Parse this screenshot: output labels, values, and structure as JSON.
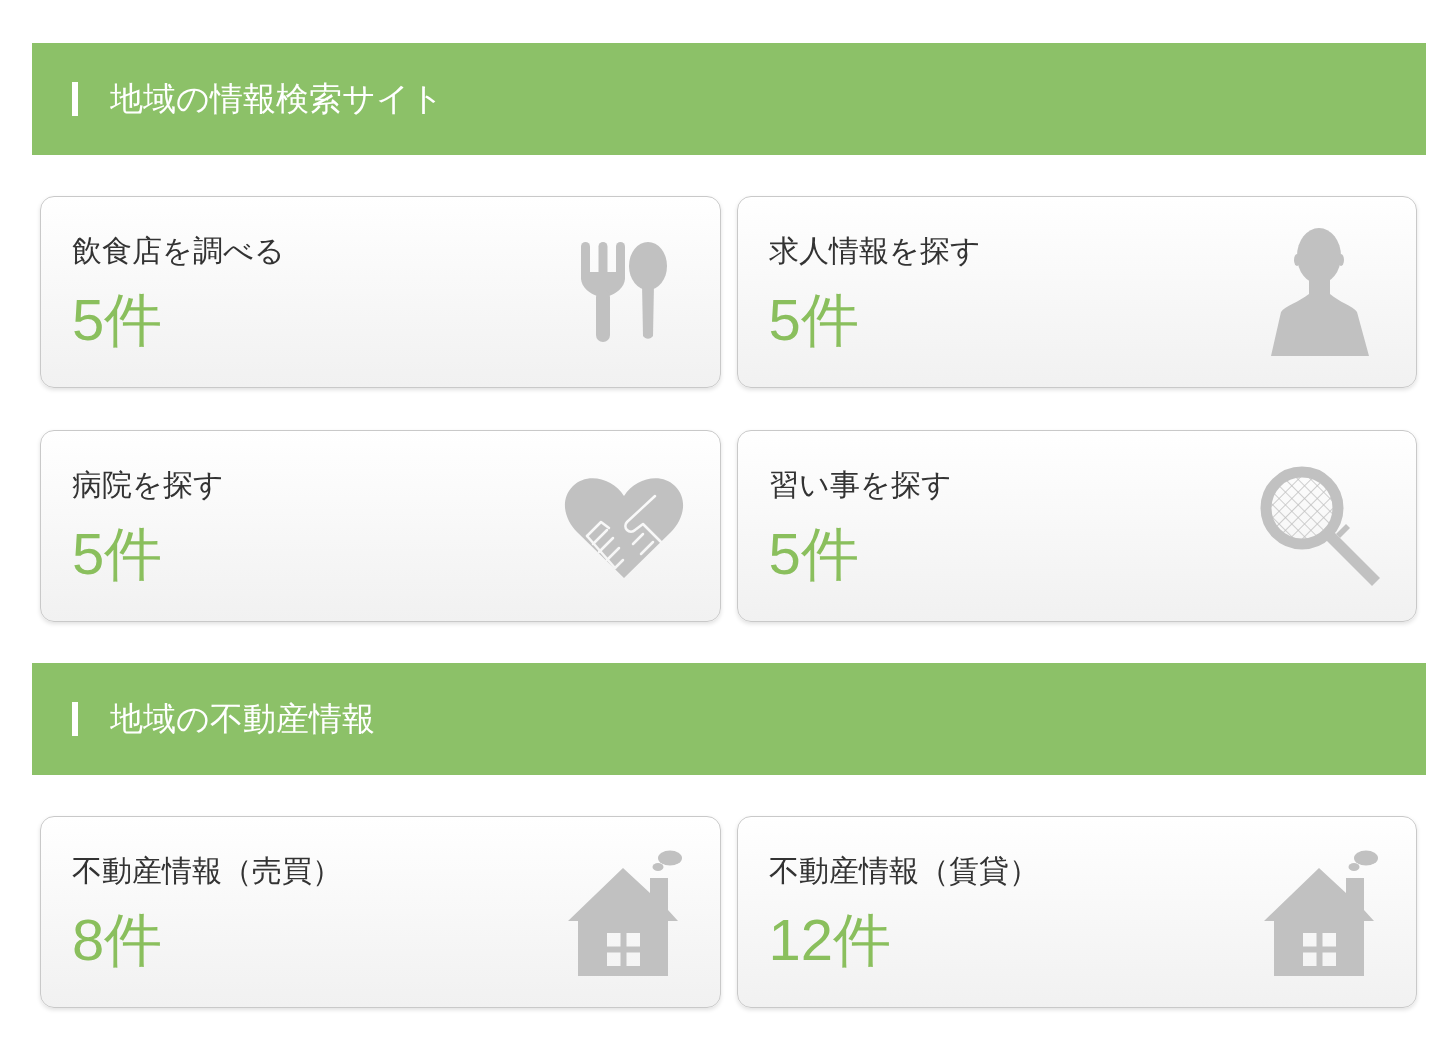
{
  "sections": [
    {
      "title": "地域の情報検索サイト",
      "cards": [
        {
          "kind": "restaurant",
          "label": "飲食店を調べる",
          "count": "5件"
        },
        {
          "kind": "jobs",
          "label": "求人情報を探す",
          "count": "5件"
        },
        {
          "kind": "hospital",
          "label": "病院を探す",
          "count": "5件"
        },
        {
          "kind": "lessons",
          "label": "習い事を探す",
          "count": "5件"
        }
      ]
    },
    {
      "title": "地域の不動産情報",
      "cards": [
        {
          "kind": "house",
          "label": "不動産情報（売買）",
          "count": "8件"
        },
        {
          "kind": "house",
          "label": "不動産情報（賃貸）",
          "count": "12件"
        }
      ]
    }
  ]
}
